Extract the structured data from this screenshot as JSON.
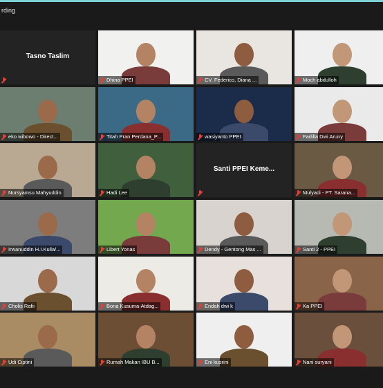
{
  "header": {
    "recording_text": "rding"
  },
  "icons": {
    "participant_muted": "muted-microphone-icon"
  },
  "participants": [
    {
      "name": "Tasno Taslim",
      "video": false
    },
    {
      "name": "Dhina PPEI",
      "video": true
    },
    {
      "name": "CV. Federico, Diana ...",
      "video": true
    },
    {
      "name": "Moch abdulloh",
      "video": true
    },
    {
      "name": "eko wibowo - Direct...",
      "video": true
    },
    {
      "name": "Titah Pran Perdana_P...",
      "video": true
    },
    {
      "name": "wasiyanto PPEI",
      "video": true
    },
    {
      "name": "Fadilla Dwi Aruny",
      "video": true
    },
    {
      "name": "Nursyamsu Mahyuddin",
      "video": true
    },
    {
      "name": "Hadi Lee",
      "video": true
    },
    {
      "name": "Santi PPEI Keme...",
      "video": false
    },
    {
      "name": "Mulyadi - PT. Sarana...",
      "video": true
    },
    {
      "name": "Irwanuddin H.I.Kulla/...",
      "video": true
    },
    {
      "name": "Libert Yonas",
      "video": true
    },
    {
      "name": "Dendy - Gentong Mas ...",
      "video": true
    },
    {
      "name": "Santi 2 - PPEI",
      "video": true,
      "active_speaker": true
    },
    {
      "name": "Cholis Rafii",
      "video": true
    },
    {
      "name": "Bona Kusuma-Atdag...",
      "video": true
    },
    {
      "name": "Endah dwi k",
      "video": true
    },
    {
      "name": "Ka PPEI",
      "video": true
    },
    {
      "name": "Udi Ciptini",
      "video": true
    },
    {
      "name": "Rumah Makan IBU B...",
      "video": true
    },
    {
      "name": "Eni kusrini",
      "video": true
    },
    {
      "name": "Nani suryani",
      "video": true
    }
  ]
}
